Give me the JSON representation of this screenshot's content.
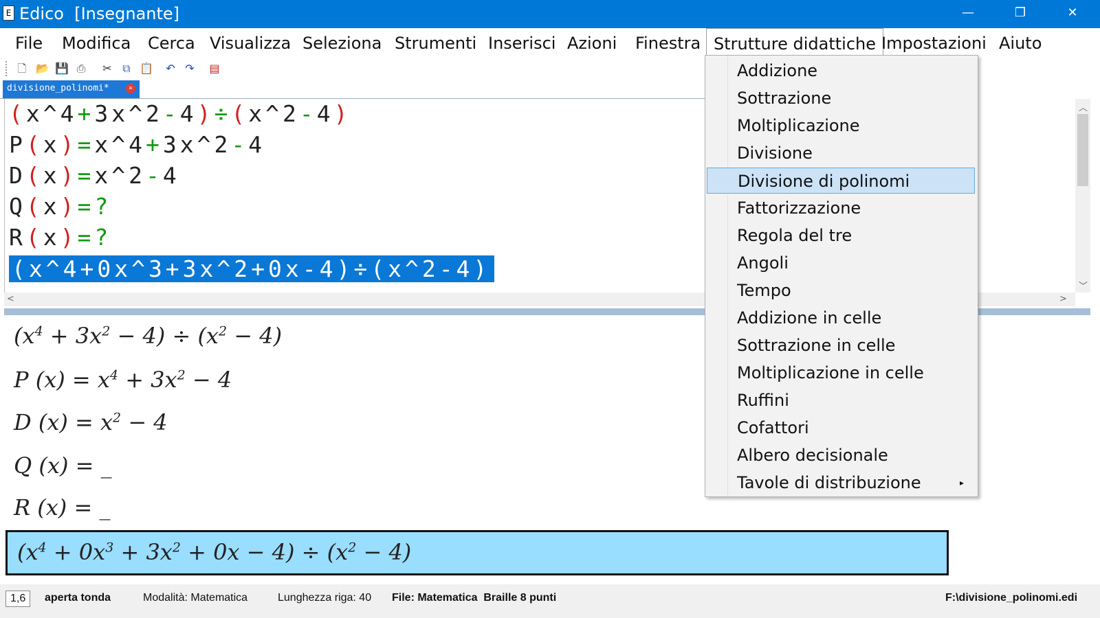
{
  "window": {
    "title": "Edico  [Insegnante]",
    "minimize": "—",
    "maximize": "❐",
    "close": "✕"
  },
  "menu": [
    "File",
    "Modifica",
    "Cerca",
    "Visualizza",
    "Seleziona",
    "Strumenti",
    "Inserisci",
    "Azioni",
    "Finestra",
    "Strutture didattiche",
    "Impostazioni",
    "Aiuto"
  ],
  "tab": {
    "label": "divisione_polinomi*",
    "close": "×"
  },
  "toolbar_icons": [
    "new-icon",
    "open-icon",
    "save-icon",
    "print-icon",
    "cut-icon",
    "copy-icon",
    "paste-icon",
    "undo-icon",
    "redo-icon",
    "pdf-icon"
  ],
  "editor": {
    "l1": {
      "a": "(",
      "b": "x^4",
      "c": "+",
      "d": "3x^2",
      "e": "-",
      "f": "4",
      "g": ")",
      "h": "÷",
      "i": "(",
      "j": "x^2",
      "k": "-",
      "l": "4",
      "m": ")"
    },
    "l2": {
      "a": "P",
      "b": "(",
      "c": "x",
      "d": ")",
      "e": "=",
      "f": "x^4",
      "g": "+",
      "h": "3x^2",
      "i": "-",
      "j": "4"
    },
    "l3": {
      "a": "D",
      "b": "(",
      "c": "x",
      "d": ")",
      "e": "=",
      "f": "x^2",
      "g": "-",
      "h": "4"
    },
    "l4": {
      "a": "Q",
      "b": "(",
      "c": "x",
      "d": ")",
      "e": "=",
      "f": "?"
    },
    "l5": {
      "a": "R",
      "b": "(",
      "c": "x",
      "d": ")",
      "e": "=",
      "f": "?"
    },
    "l6": "(x^4+0x^3+3x^2+0x-4)÷(x^2-4)"
  },
  "preview": {
    "p1": {
      "a": "(x",
      "b": "4",
      "c": " + 3x",
      "d": "2",
      "e": " − 4) ÷ (x",
      "f": "2",
      "g": " − 4)"
    },
    "p2": {
      "a": "P (x) = x",
      "b": "4",
      "c": " + 3x",
      "d": "2",
      "e": " − 4"
    },
    "p3": {
      "a": "D (x) = x",
      "b": "2",
      "c": " − 4"
    },
    "p4": "Q (x) = _",
    "p5": "R (x) = _",
    "p6": {
      "a": "(x",
      "b": "4",
      "c": " + 0x",
      "d": "3",
      "e": " + 3x",
      "f": "2",
      "g": " + 0x − 4) ÷ (x",
      "h": "2",
      "i": " − 4)"
    }
  },
  "status": {
    "position": "1,6",
    "symbol": "aperta tonda",
    "mode": "Modalità: Matematica",
    "line_length": "Lunghezza riga: 40",
    "file_info": "File: Matematica  Braille 8 punti",
    "path": "F:\\divisione_polinomi.edi"
  },
  "dropdown": {
    "items": [
      "Addizione",
      "Sottrazione",
      "Moltiplicazione",
      "Divisione",
      "Divisione di polinomi",
      "Fattorizzazione",
      "Regola del tre",
      "Angoli",
      "Tempo",
      "Addizione in celle",
      "Sottrazione in celle",
      "Moltiplicazione in celle",
      "Ruffini",
      "Cofattori",
      "Albero decisionale",
      "Tavole di distribuzione"
    ],
    "highlighted": "Divisione di polinomi",
    "submenu_arrow": "▸"
  },
  "colors": {
    "titlebar": "#0078d7",
    "selection": "#0a78d7",
    "highlight_box": "#99ddff",
    "paren_red": "#d02020",
    "operator_green": "#129a12"
  }
}
